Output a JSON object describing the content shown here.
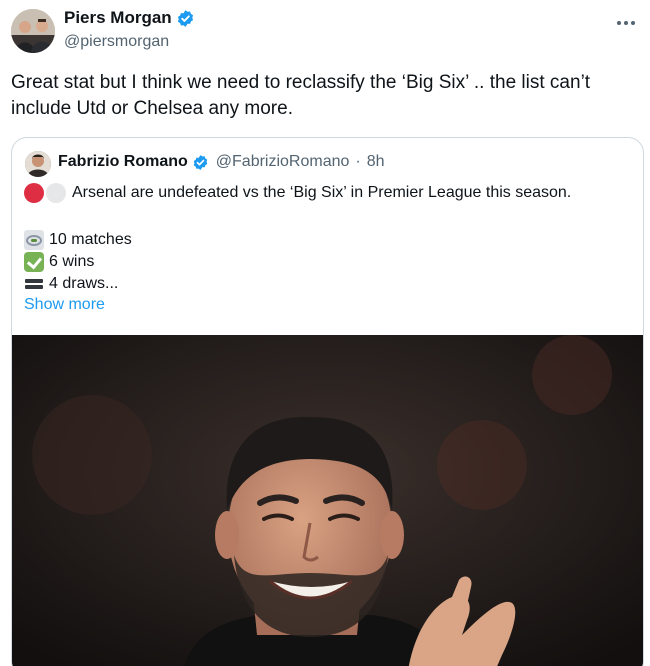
{
  "author": {
    "display_name": "Piers Morgan",
    "handle": "@piersmorgan",
    "verified": true
  },
  "more_icon": "more-options-icon",
  "tweet": {
    "text": "Great stat but I think we need to reclassify the ‘Big Six’ .. the list can’t include Utd or Chelsea any more."
  },
  "quoted": {
    "display_name": "Fabrizio Romano",
    "handle": "@FabrizioRomano",
    "separator": "·",
    "time": "8h",
    "verified": true,
    "line1": "Arsenal are undefeated vs the ‘Big Six’ in Premier League this season.",
    "stats": [
      {
        "icon": "stadium-icon",
        "text": "10 matches"
      },
      {
        "icon": "check-mark-icon",
        "text": "6 wins"
      },
      {
        "icon": "equals-icon",
        "text": "4 draws..."
      }
    ],
    "show_more": "Show more",
    "colors": {
      "link": "#1d9bf0",
      "verified": "#1d9bf0",
      "muted": "#536471"
    }
  }
}
